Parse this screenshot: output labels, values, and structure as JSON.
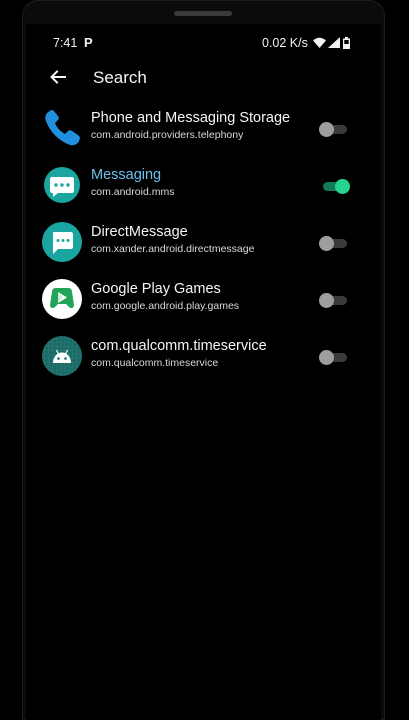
{
  "status_bar": {
    "time": "7:41",
    "p_glyph": "P",
    "net_speed": "0.02 K/s",
    "icons": [
      "wifi-icon",
      "signal-icon",
      "battery-icon"
    ]
  },
  "app_bar": {
    "back_icon": "arrow-left-icon",
    "title": "Search"
  },
  "apps": [
    {
      "name": "Phone and Messaging Storage",
      "package": "com.android.providers.telephony",
      "icon": "phone-icon",
      "enabled": false,
      "highlighted": false
    },
    {
      "name": "Messaging",
      "package": "com.android.mms",
      "icon": "messaging-icon",
      "enabled": true,
      "highlighted": true
    },
    {
      "name": "DirectMessage",
      "package": "com.xander.android.directmessage",
      "icon": "direct-message-icon",
      "enabled": false,
      "highlighted": false
    },
    {
      "name": "Google Play Games",
      "package": "com.google.android.play.games",
      "icon": "play-games-icon",
      "enabled": false,
      "highlighted": false
    },
    {
      "name": "com.qualcomm.timeservice",
      "package": "com.qualcomm.timeservice",
      "icon": "android-icon",
      "enabled": false,
      "highlighted": false
    }
  ],
  "colors": {
    "background": "#000000",
    "highlight_text": "#6fc0ef",
    "toggle_on": "#25d48f",
    "toggle_off": "#9e9e9e"
  }
}
